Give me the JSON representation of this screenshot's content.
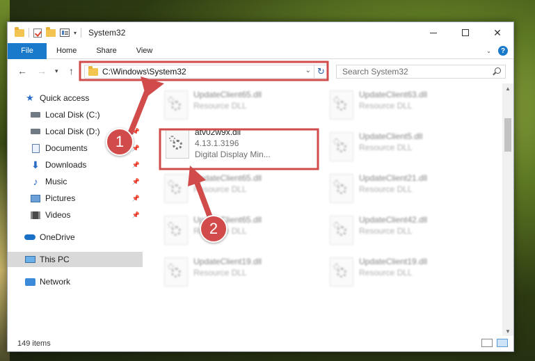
{
  "window": {
    "title": "System32",
    "controls": [
      "minimize",
      "maximize",
      "close"
    ]
  },
  "ribbon": {
    "tabs": [
      "File",
      "Home",
      "Share",
      "View"
    ],
    "help_glyph": "?"
  },
  "navigation": {
    "address": "C:\\Windows\\System32",
    "search_placeholder": "Search System32"
  },
  "sidebar": {
    "items": [
      {
        "label": "Quick access",
        "icon": "star-icon"
      },
      {
        "label": "Local Disk (C:)",
        "icon": "drive-icon"
      },
      {
        "label": "Local Disk (D:)",
        "icon": "drive-icon"
      },
      {
        "label": "Documents",
        "icon": "documents-icon"
      },
      {
        "label": "Downloads",
        "icon": "downloads-icon"
      },
      {
        "label": "Music",
        "icon": "music-icon"
      },
      {
        "label": "Pictures",
        "icon": "pictures-icon"
      },
      {
        "label": "Videos",
        "icon": "videos-icon"
      },
      {
        "label": "OneDrive",
        "icon": "onedrive-icon"
      },
      {
        "label": "This PC",
        "icon": "this-pc-icon"
      },
      {
        "label": "Network",
        "icon": "network-icon"
      }
    ]
  },
  "files": [
    {
      "name": "UpdateClient65.dll",
      "type": "Resource DLL"
    },
    {
      "name": "UpdateClient63.dll",
      "type": "Resource DLL"
    },
    {
      "name": "atv02w9x.dll",
      "version": "4.13.1.3196",
      "description": "Digital Display Min..."
    },
    {
      "name": "UpdateClient5.dll",
      "type": "Resource DLL"
    },
    {
      "name": "UpdateClient65.dll",
      "type": "Resource DLL"
    },
    {
      "name": "UpdateClient21.dll",
      "type": "Resource DLL"
    },
    {
      "name": "UpdateClient65.dll",
      "type": "Resource DLL"
    },
    {
      "name": "UpdateClient42.dll",
      "type": "Resource DLL"
    },
    {
      "name": "UpdateClient19.dll",
      "type": "Resource DLL"
    },
    {
      "name": "UpdateClient19.dll",
      "type": "Resource DLL"
    }
  ],
  "status": {
    "item_count": "149 items"
  },
  "annotations": {
    "step1": "1",
    "step2": "2",
    "color": "#d14b4b"
  }
}
